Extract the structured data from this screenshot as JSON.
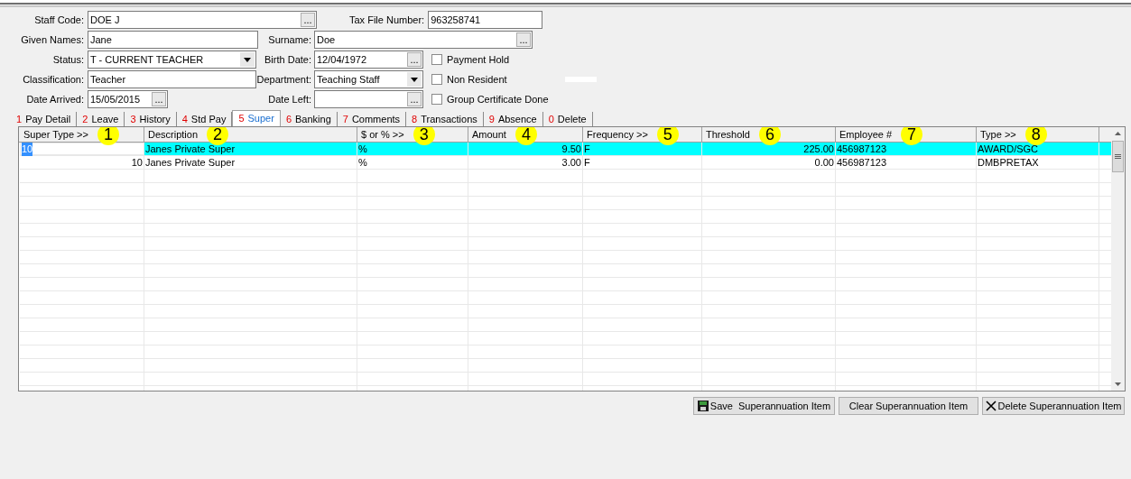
{
  "form": {
    "fields": [
      {
        "label": "Staff Code:",
        "value": "DOE J",
        "kind": "lookup",
        "button": "..."
      },
      {
        "label": "Tax File Number:",
        "value": "963258741",
        "kind": "text"
      },
      {
        "label": "Given Names:",
        "value": "Jane",
        "kind": "text"
      },
      {
        "label": "Surname:",
        "value": "Doe",
        "kind": "lookup",
        "button": "..."
      },
      {
        "label": "Status:",
        "value": "T - CURRENT TEACHER",
        "kind": "dropdown"
      },
      {
        "label": "Birth Date:",
        "value": "12/04/1972",
        "kind": "lookup",
        "button": "..."
      },
      {
        "label": "Classification:",
        "value": "Teacher",
        "kind": "text"
      },
      {
        "label": "Department:",
        "value": "Teaching Staff",
        "kind": "dropdown"
      },
      {
        "label": "Date Arrived:",
        "value": "15/05/2015",
        "kind": "lookup",
        "button": "..."
      },
      {
        "label": "Date Left:",
        "kind": "lookup",
        "button": "..."
      }
    ],
    "checkboxes": [
      {
        "label": "Payment Hold",
        "checked": false
      },
      {
        "label": "Non Resident",
        "checked": false
      },
      {
        "label": "Group Certificate Done",
        "checked": false
      }
    ]
  },
  "tabs": [
    {
      "number": "1",
      "label": "Pay Detail",
      "selected": false
    },
    {
      "number": "2",
      "label": "Leave",
      "selected": false
    },
    {
      "number": "3",
      "label": "History",
      "selected": false
    },
    {
      "number": "4",
      "label": "Std Pay",
      "selected": false
    },
    {
      "number": "5",
      "label": "Super",
      "selected": true
    },
    {
      "number": "6",
      "label": "Banking",
      "selected": false
    },
    {
      "number": "7",
      "label": "Comments",
      "selected": false
    },
    {
      "number": "8",
      "label": "Transactions",
      "selected": false
    },
    {
      "number": "9",
      "label": "Absence",
      "selected": false
    },
    {
      "number": "0",
      "label": "Delete",
      "selected": false
    }
  ],
  "table": {
    "columns": [
      {
        "label": "Super Type >>",
        "marker": "1"
      },
      {
        "label": "Description",
        "marker": "2"
      },
      {
        "label": "$ or % >>",
        "marker": "3"
      },
      {
        "label": "Amount",
        "marker": "4"
      },
      {
        "label": "Frequency >>",
        "marker": "5"
      },
      {
        "label": "Threshold",
        "marker": "6"
      },
      {
        "label": "Employee #",
        "marker": "7"
      },
      {
        "label": "Type >>",
        "marker": "8"
      }
    ],
    "rows": [
      {
        "selected": true,
        "cells": [
          "10",
          "Janes Private Super",
          "%",
          "9.50",
          "F",
          "225.00",
          "456987123",
          "AWARD/SGC"
        ]
      },
      {
        "selected": false,
        "cells": [
          "10",
          "Janes Private Super",
          "%",
          "3.00",
          "F",
          "0.00",
          "456987123",
          "DMBPRETAX"
        ]
      }
    ]
  },
  "buttons": [
    {
      "label": "Save  Superannuation Item",
      "kind": "save"
    },
    {
      "label": "Clear Superannuation Item",
      "kind": "plain"
    },
    {
      "label": "Delete Superannuation Item",
      "kind": "delete"
    }
  ]
}
